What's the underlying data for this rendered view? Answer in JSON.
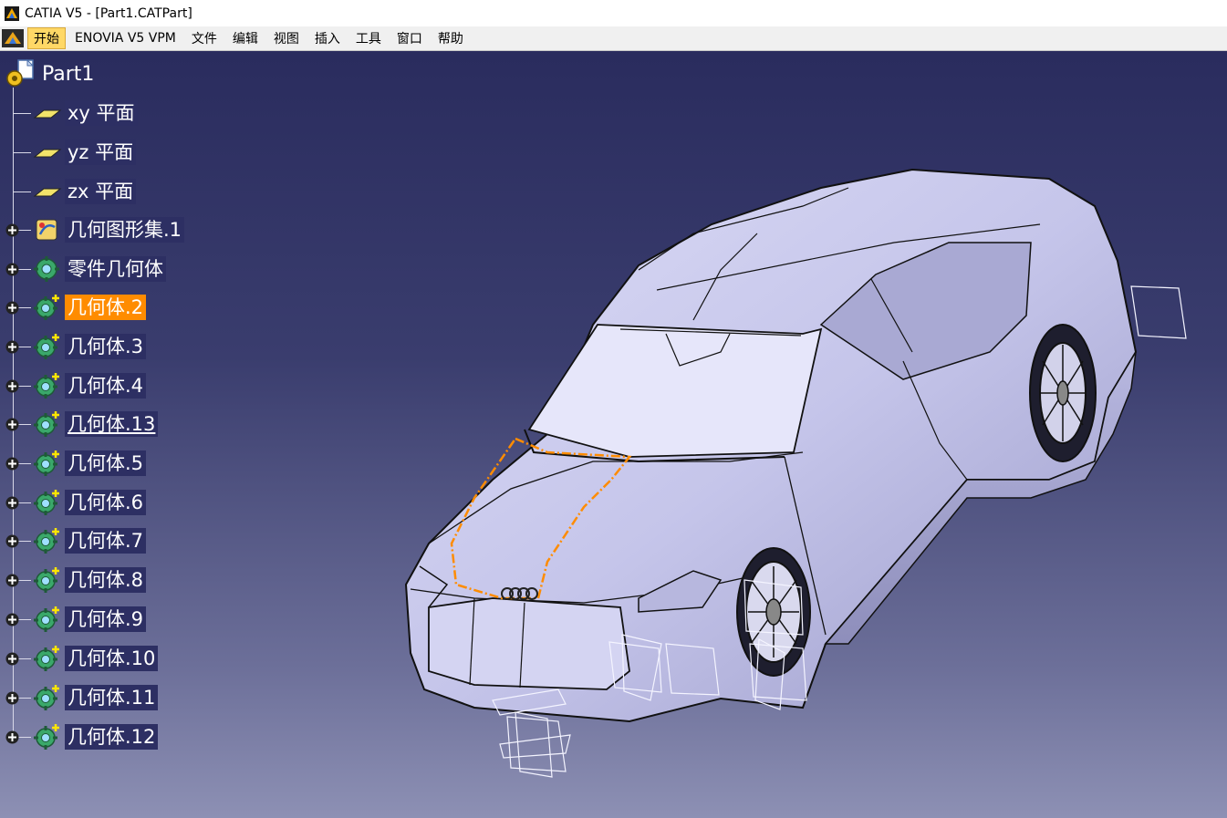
{
  "window": {
    "title": "CATIA V5 - [Part1.CATPart]"
  },
  "menu": {
    "items": [
      {
        "label": "开始",
        "active": true
      },
      {
        "label": "ENOVIA V5 VPM",
        "active": false
      },
      {
        "label": "文件",
        "active": false
      },
      {
        "label": "编辑",
        "active": false
      },
      {
        "label": "视图",
        "active": false
      },
      {
        "label": "插入",
        "active": false
      },
      {
        "label": "工具",
        "active": false
      },
      {
        "label": "窗口",
        "active": false
      },
      {
        "label": "帮助",
        "active": false
      }
    ]
  },
  "tree": {
    "root": {
      "label": "Part1",
      "icon": "part-icon"
    },
    "nodes": [
      {
        "label": "xy 平面",
        "icon": "plane-icon",
        "expandable": false,
        "state": "normal"
      },
      {
        "label": "yz 平面",
        "icon": "plane-icon",
        "expandable": false,
        "state": "normal"
      },
      {
        "label": "zx 平面",
        "icon": "plane-icon",
        "expandable": false,
        "state": "normal"
      },
      {
        "label": "几何图形集.1",
        "icon": "geometrical-set-icon",
        "expandable": true,
        "state": "normal"
      },
      {
        "label": "零件几何体",
        "icon": "part-body-icon",
        "expandable": true,
        "state": "normal"
      },
      {
        "label": "几何体.2",
        "icon": "body-icon",
        "expandable": true,
        "state": "selected"
      },
      {
        "label": "几何体.3",
        "icon": "body-icon",
        "expandable": true,
        "state": "normal"
      },
      {
        "label": "几何体.4",
        "icon": "body-icon",
        "expandable": true,
        "state": "normal"
      },
      {
        "label": "几何体.13",
        "icon": "body-icon",
        "expandable": true,
        "state": "in-work"
      },
      {
        "label": "几何体.5",
        "icon": "body-icon",
        "expandable": true,
        "state": "normal"
      },
      {
        "label": "几何体.6",
        "icon": "body-icon",
        "expandable": true,
        "state": "normal"
      },
      {
        "label": "几何体.7",
        "icon": "body-icon",
        "expandable": true,
        "state": "normal"
      },
      {
        "label": "几何体.8",
        "icon": "body-icon",
        "expandable": true,
        "state": "normal"
      },
      {
        "label": "几何体.9",
        "icon": "body-icon",
        "expandable": true,
        "state": "normal"
      },
      {
        "label": "几何体.10",
        "icon": "body-icon",
        "expandable": true,
        "state": "normal"
      },
      {
        "label": "几何体.11",
        "icon": "body-icon",
        "expandable": true,
        "state": "normal"
      },
      {
        "label": "几何体.12",
        "icon": "body-icon",
        "expandable": true,
        "state": "normal"
      }
    ]
  },
  "colors": {
    "selection": "#ff8c00",
    "label_background": "#2d2f63",
    "viewport_top": "#2a2c5e",
    "viewport_bottom": "#8d90b4",
    "model_surface": "#c8c8ee",
    "highlight_edge": "#ff8c00"
  }
}
